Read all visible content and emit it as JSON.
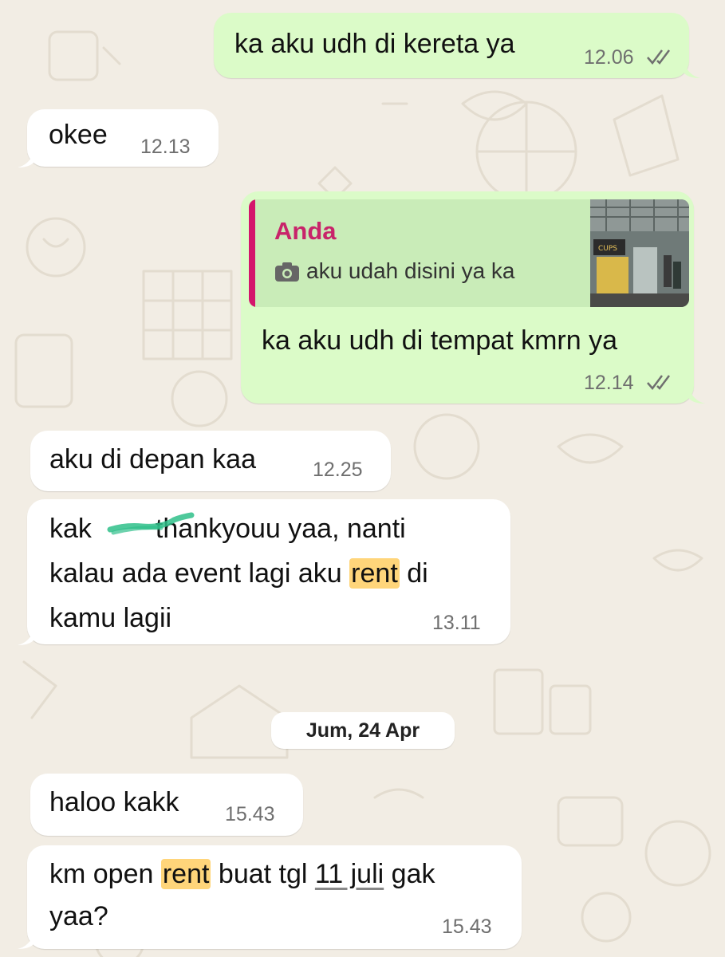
{
  "messages": [
    {
      "id": "m1",
      "direction": "outgoing",
      "text": "ka aku udh di kereta ya",
      "time": "12.06",
      "status": "read"
    },
    {
      "id": "m2",
      "direction": "incoming",
      "text": "okee",
      "time": "12.13"
    },
    {
      "id": "m3",
      "direction": "outgoing",
      "reply_to": {
        "author": "Anda",
        "icon": "camera-icon",
        "text": "aku udah disini ya ka"
      },
      "text": "ka aku udh di tempat kmrn ya",
      "time": "12.14",
      "status": "read"
    },
    {
      "id": "m4",
      "direction": "incoming",
      "text": "aku di depan kaa",
      "time": "12.25"
    },
    {
      "id": "m5",
      "direction": "incoming",
      "lines": [
        "kak",
        "thankyouu yaa, nanti",
        "kalau ada event lagi aku",
        "rent",
        "di",
        "kamu lagii"
      ],
      "time": "13.11"
    },
    {
      "id": "m6",
      "direction": "incoming",
      "text": "haloo kakk",
      "time": "15.43"
    },
    {
      "id": "m7",
      "direction": "incoming",
      "parts": [
        "km open",
        "rent",
        "buat tgl",
        "11 juli",
        "gak",
        "yaa?"
      ],
      "time": "15.43"
    }
  ],
  "date_separator": "Jum, 24 Apr",
  "colors": {
    "background": "#f2ede4",
    "incoming_bubble": "#ffffff",
    "outgoing_bubble": "#dbfbc8",
    "quote_bar": "#d4156c",
    "quote_author": "#c8246a",
    "highlight": "#ffd57a",
    "tick_color": "#6f6f6f"
  }
}
